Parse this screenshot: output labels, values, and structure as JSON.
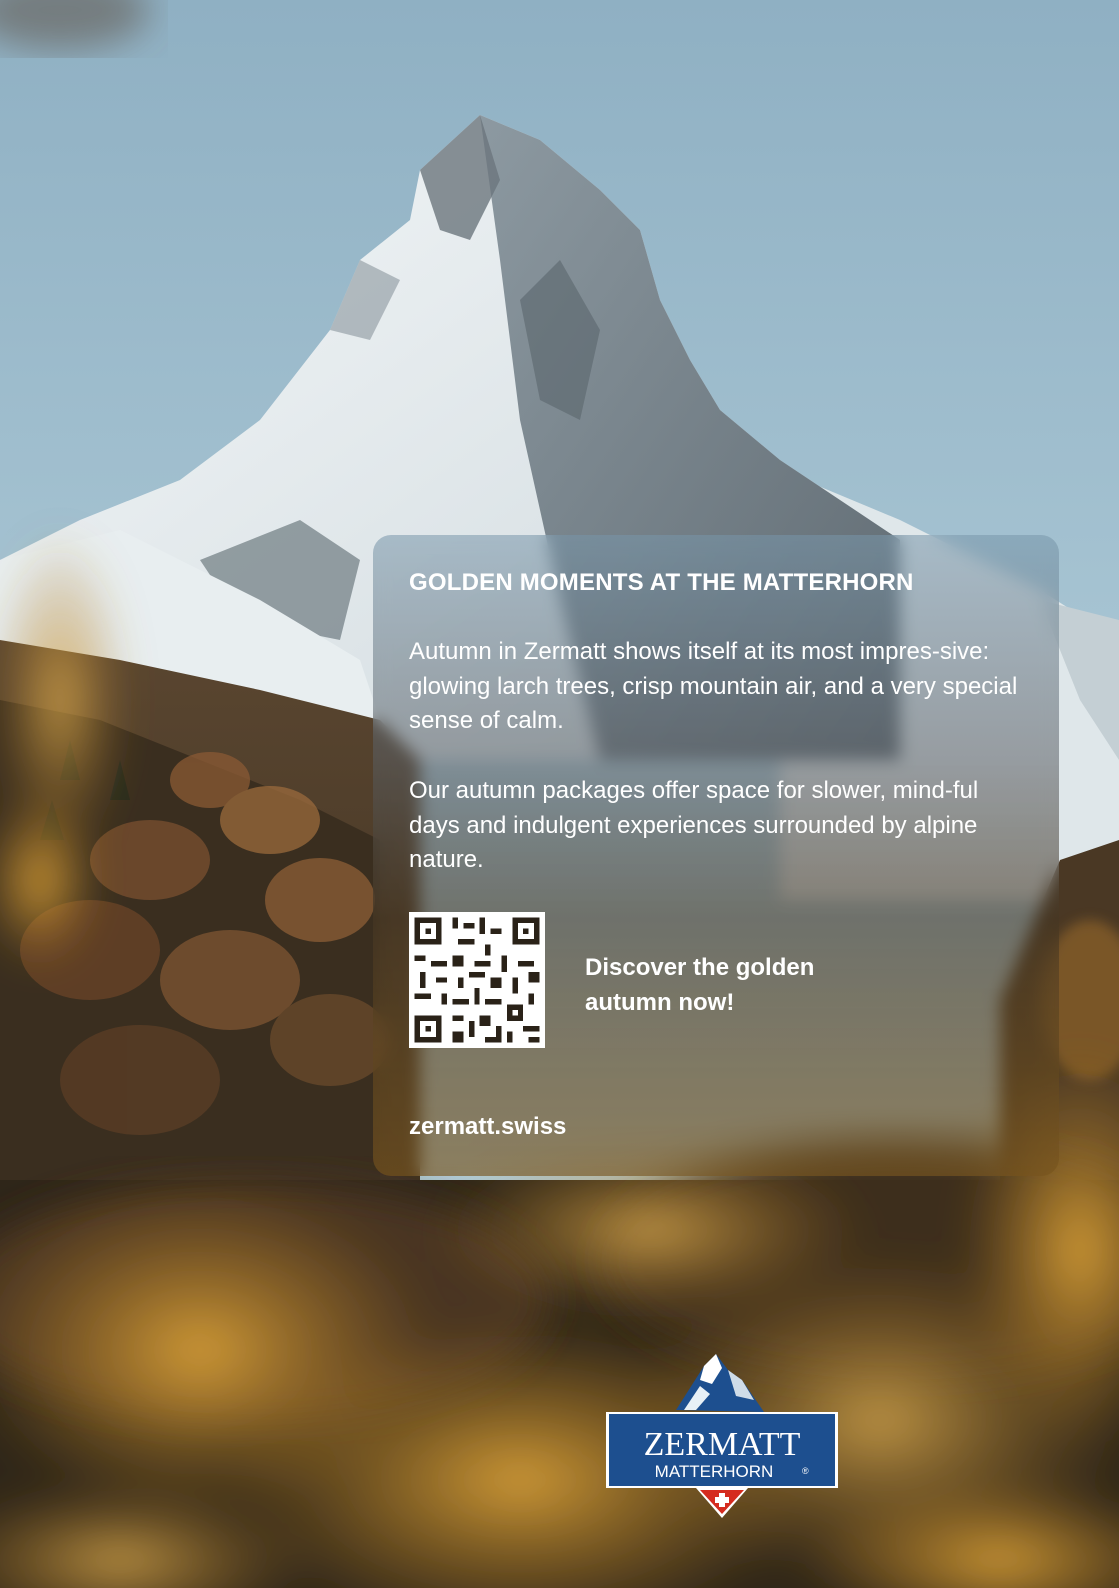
{
  "card": {
    "title": "GOLDEN MOMENTS AT THE MATTERHORN",
    "paragraph1": "Autumn in Zermatt shows itself at its most impres-sive: glowing larch trees, crisp mountain air, and a very special sense of calm.",
    "paragraph2": "Our autumn packages offer space for slower, mind-ful days and indulgent experiences surrounded by alpine nature.",
    "cta": "Discover the golden autumn now!",
    "url": "zermatt.swiss"
  },
  "logo": {
    "line1": "ZERMATT",
    "line2": "MATTERHORN",
    "mark": "®"
  },
  "colors": {
    "sky": "#9fbccb",
    "snow": "#eef2f4",
    "rock": "#5d6a73",
    "larch": "#c8902e",
    "forest": "#2b2619",
    "logo_blue": "#1d4f8f",
    "swiss_red": "#d52b1e"
  }
}
